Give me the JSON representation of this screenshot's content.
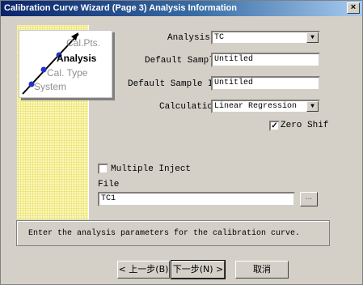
{
  "window": {
    "title": "Calibration Curve Wizard (Page 3) Analysis Information",
    "close_glyph": "×"
  },
  "steps": [
    {
      "label": "Cal.Pts."
    },
    {
      "label": "Analysis"
    },
    {
      "label": "Cal. Type"
    },
    {
      "label": "System"
    }
  ],
  "form": {
    "analysis_label": "Analysis:",
    "analysis_value": "TC",
    "default_sample_label": "Default Sample",
    "default_sample_value": "Untitled",
    "default_sample_id_label": "Default Sample ID:",
    "default_sample_id_value": "Untitled",
    "calculation_label": "Calculation",
    "calculation_value": "Linear Regression",
    "zero_shift_label": "Zero Shif",
    "zero_shift_checked": true,
    "multiple_inject_label": "Multiple Inject",
    "multiple_inject_checked": false,
    "file_label": "File",
    "file_value": "TC1",
    "browse_label": "..."
  },
  "info_text": "Enter the analysis parameters for the calibration curve.",
  "buttons": {
    "back": "< 上一步(B)",
    "next": "下一步(N) >",
    "cancel": "取消"
  },
  "icons": {
    "dropdown": "chevron-down-icon",
    "check": "checkmark-icon"
  }
}
